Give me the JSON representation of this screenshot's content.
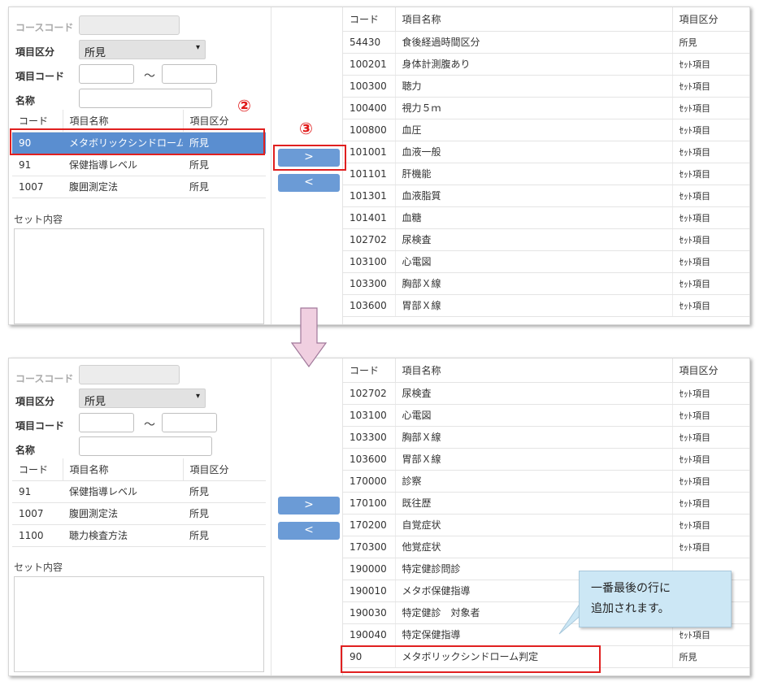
{
  "form": {
    "course_code_label": "コースコード",
    "item_category_label": "項目区分",
    "item_category_value": "所見",
    "select_arrow": "▾",
    "item_code_label": "項目コード",
    "range_sep": "～",
    "name_label": "名称",
    "set_contents_label": "セット内容"
  },
  "left_headers": [
    "コード",
    "項目名称",
    "項目区分"
  ],
  "top_left_rows": [
    {
      "code": "90",
      "name": "メタボリックシンドローム判定",
      "cat": "所見"
    },
    {
      "code": "91",
      "name": "保健指導レベル",
      "cat": "所見"
    },
    {
      "code": "1007",
      "name": "腹囲測定法",
      "cat": "所見"
    }
  ],
  "bottom_left_rows": [
    {
      "code": "91",
      "name": "保健指導レベル",
      "cat": "所見"
    },
    {
      "code": "1007",
      "name": "腹囲測定法",
      "cat": "所見"
    },
    {
      "code": "1100",
      "name": "聴力検査方法",
      "cat": "所見"
    }
  ],
  "buttons": {
    "add": ">",
    "remove": "<"
  },
  "right_headers": [
    "コード",
    "項目名称",
    "項目区分"
  ],
  "top_right_rows": [
    {
      "code": "54430",
      "name": "食後経過時間区分",
      "cat": "所見"
    },
    {
      "code": "100201",
      "name": "身体計測腹あり",
      "cat": "ｾｯﾄ項目"
    },
    {
      "code": "100300",
      "name": "聴力",
      "cat": "ｾｯﾄ項目"
    },
    {
      "code": "100400",
      "name": "視力５ｍ",
      "cat": "ｾｯﾄ項目"
    },
    {
      "code": "100800",
      "name": "血圧",
      "cat": "ｾｯﾄ項目"
    },
    {
      "code": "101001",
      "name": "血液一般",
      "cat": "ｾｯﾄ項目"
    },
    {
      "code": "101101",
      "name": "肝機能",
      "cat": "ｾｯﾄ項目"
    },
    {
      "code": "101301",
      "name": "血液脂質",
      "cat": "ｾｯﾄ項目"
    },
    {
      "code": "101401",
      "name": "血糖",
      "cat": "ｾｯﾄ項目"
    },
    {
      "code": "102702",
      "name": "尿検査",
      "cat": "ｾｯﾄ項目"
    },
    {
      "code": "103100",
      "name": "心電図",
      "cat": "ｾｯﾄ項目"
    },
    {
      "code": "103300",
      "name": "胸部Ｘ線",
      "cat": "ｾｯﾄ項目"
    },
    {
      "code": "103600",
      "name": "胃部Ｘ線",
      "cat": "ｾｯﾄ項目"
    }
  ],
  "bottom_right_rows": [
    {
      "code": "102702",
      "name": "尿検査",
      "cat": "ｾｯﾄ項目"
    },
    {
      "code": "103100",
      "name": "心電図",
      "cat": "ｾｯﾄ項目"
    },
    {
      "code": "103300",
      "name": "胸部Ｘ線",
      "cat": "ｾｯﾄ項目"
    },
    {
      "code": "103600",
      "name": "胃部Ｘ線",
      "cat": "ｾｯﾄ項目"
    },
    {
      "code": "170000",
      "name": "診察",
      "cat": "ｾｯﾄ項目"
    },
    {
      "code": "170100",
      "name": "既往歴",
      "cat": "ｾｯﾄ項目"
    },
    {
      "code": "170200",
      "name": "自覚症状",
      "cat": "ｾｯﾄ項目"
    },
    {
      "code": "170300",
      "name": "他覚症状",
      "cat": "ｾｯﾄ項目"
    },
    {
      "code": "190000",
      "name": "特定健診問診",
      "cat": ""
    },
    {
      "code": "190010",
      "name": "メタボ保健指導",
      "cat": ""
    },
    {
      "code": "190030",
      "name": "特定健診　対象者",
      "cat": ""
    },
    {
      "code": "190040",
      "name": "特定保健指導",
      "cat": "ｾｯﾄ項目"
    },
    {
      "code": "90",
      "name": "メタボリックシンドローム判定",
      "cat": "所見"
    }
  ],
  "annotations": {
    "step2": "②",
    "step3": "③",
    "callout_line1": "一番最後の行に",
    "callout_line2": "追加されます。"
  },
  "colors": {
    "selected_row": "#5a8ed0",
    "button": "#6b9bd6",
    "highlight": "#e02020",
    "arrow_fill": "#f0cfe0",
    "callout": "#cce7f5"
  }
}
